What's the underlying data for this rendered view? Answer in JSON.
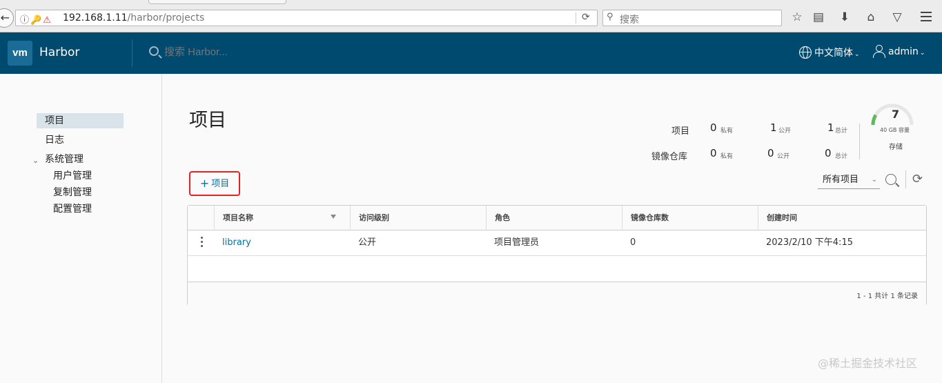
{
  "browser": {
    "url_host": "192.168.1.11",
    "url_path": "/harbor/projects",
    "search_placeholder": "搜索"
  },
  "header": {
    "logo": "vm",
    "app_title": "Harbor",
    "search_placeholder": "搜索 Harbor...",
    "language": "中文简体",
    "user": "admin"
  },
  "sidebar": {
    "items": [
      {
        "label": "项目"
      },
      {
        "label": "日志"
      },
      {
        "label": "系统管理"
      },
      {
        "label": "用户管理"
      },
      {
        "label": "复制管理"
      },
      {
        "label": "配置管理"
      }
    ]
  },
  "page": {
    "title": "项目",
    "stats": {
      "projects_label": "项目",
      "repos_label": "镜像仓库",
      "private_label": "私有",
      "public_label": "公开",
      "total_label": "总计",
      "projects": {
        "private": "0",
        "public": "1",
        "total": "1"
      },
      "repos": {
        "private": "0",
        "public": "0",
        "total": "0"
      }
    },
    "storage": {
      "value": "7",
      "capacity_label": "40 GB 容量",
      "label": "存储",
      "fraction_used": 0.17
    },
    "new_project_button": "项目",
    "filter": "所有项目"
  },
  "table": {
    "columns": [
      "项目名称",
      "访问级别",
      "角色",
      "镜像仓库数",
      "创建时间"
    ],
    "rows": [
      {
        "name": "library",
        "access": "公开",
        "role": "项目管理员",
        "repos": "0",
        "created": "2023/2/10 下午4:15"
      }
    ],
    "footer": "1 - 1 共计 1 条记录"
  },
  "watermark": "@稀土掘金技术社区",
  "colors": {
    "header_bg": "#004a70",
    "link": "#0072a3",
    "highlight_box": "#e52020",
    "gauge": "#5fb85f"
  }
}
